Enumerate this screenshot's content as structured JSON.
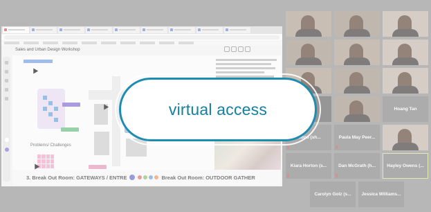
{
  "overlay": {
    "label": "virtual access"
  },
  "shared_screen": {
    "board_title": "Sales and Urban Design Workshop",
    "canvas_label": "Problems/ Challenges",
    "breakout_left": "3. Break Out Room: GATEWAYS / ENTRE",
    "breakout_right": "Break Out Room: OUTDOOR GATHER"
  },
  "participants": {
    "hoang": "Hoang Tan",
    "aidoo": "Aidoo (sh...",
    "paula": "Paula May Peer...",
    "kiara": "Kiara Horton (s...",
    "dan": "Dan McGrath (h...",
    "hayley": "Hayley Owens (...",
    "carolyn": "Carolyn Golz (s...",
    "jessica": "Jessica Williams..."
  },
  "colors": {
    "accent": "#127fa3",
    "highlight": "#d8e29a"
  }
}
